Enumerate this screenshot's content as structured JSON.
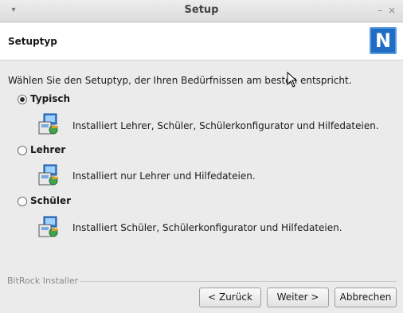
{
  "window": {
    "title": "Setup",
    "menu_glyph": "▾",
    "min_glyph": "–",
    "close_glyph": "×"
  },
  "header": {
    "title": "Setuptyp",
    "logo_letter": "N",
    "logo_color": "#1f6dc4"
  },
  "content": {
    "intro": "Wählen Sie den Setuptyp, der Ihren Bedürfnissen am besten entspricht.",
    "options": [
      {
        "label": "Typisch",
        "description": "Installiert Lehrer, Schüler, Schülerkonfigurator und Hilfedateien.",
        "selected": true,
        "icon": "installer-package-icon"
      },
      {
        "label": "Lehrer",
        "description": "Installiert nur Lehrer und Hilfedateien.",
        "selected": false,
        "icon": "installer-package-icon"
      },
      {
        "label": "Schüler",
        "description": "Installiert Schüler, Schülerkonfigurator und Hilfedateien.",
        "selected": false,
        "icon": "installer-package-icon"
      }
    ]
  },
  "footer": {
    "group_label": "BitRock Installer",
    "back_label": "< Zurück",
    "next_label": "Weiter >",
    "cancel_label": "Abbrechen"
  }
}
